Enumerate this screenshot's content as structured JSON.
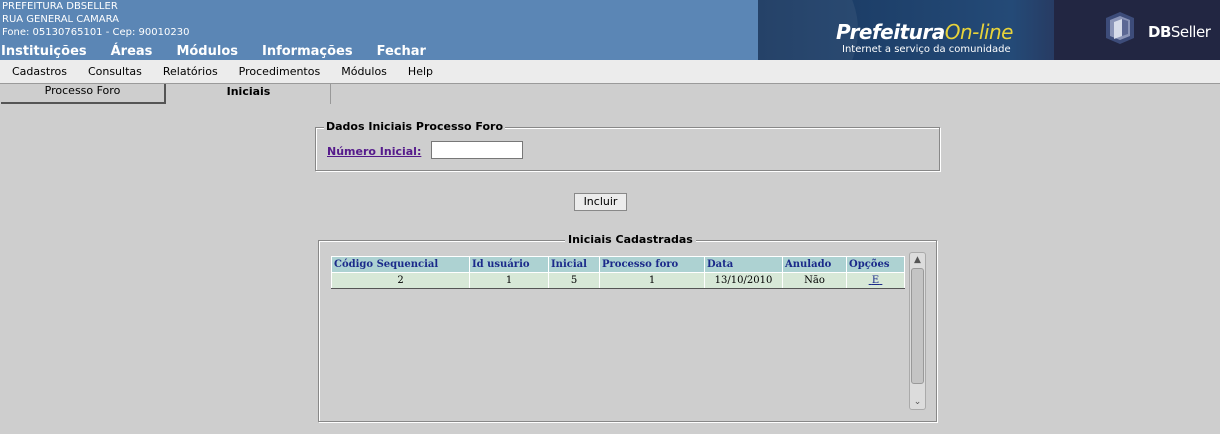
{
  "header": {
    "org_name": "PREFEITURA DBSELLER",
    "address": "RUA GENERAL CAMARA",
    "contact": "Fone: 05130765101  -  Cep: 90010230",
    "nav": [
      "Instituições",
      "Áreas",
      "Módulos",
      "Informações",
      "Fechar"
    ],
    "banner_title_main": "Prefeitura",
    "banner_title_accent": "On-line",
    "banner_subtitle": "Internet a serviço da comunidade",
    "brand_db": "DB",
    "brand_seller": "Seller"
  },
  "menu": [
    "Cadastros",
    "Consultas",
    "Relatórios",
    "Procedimentos",
    "Módulos",
    "Help"
  ],
  "tabs": [
    "Processo Foro",
    "Iniciais"
  ],
  "form": {
    "legend": "Dados Iniciais Processo Foro",
    "numero_label": "Número Inicial:",
    "numero_value": ""
  },
  "incluir_label": "Incluir",
  "list": {
    "legend": "Iniciais Cadastradas",
    "columns": [
      "Código Sequencial",
      "Id usuário",
      "Inicial",
      "Processo foro",
      "Data",
      "Anulado",
      "Opções"
    ],
    "rows": [
      [
        "2",
        "1",
        "5",
        "1",
        "13/10/2010",
        "Não",
        "E"
      ]
    ]
  },
  "colors": {
    "header_bg": "#5b86b5",
    "banner_accent": "#e8d33a",
    "grid_header_bg": "#add2d2",
    "grid_row_bg": "#d7e8d7",
    "link": "#551a8b"
  },
  "scrollbar": {
    "up_icon": "▲",
    "down_icon": "⌄"
  }
}
